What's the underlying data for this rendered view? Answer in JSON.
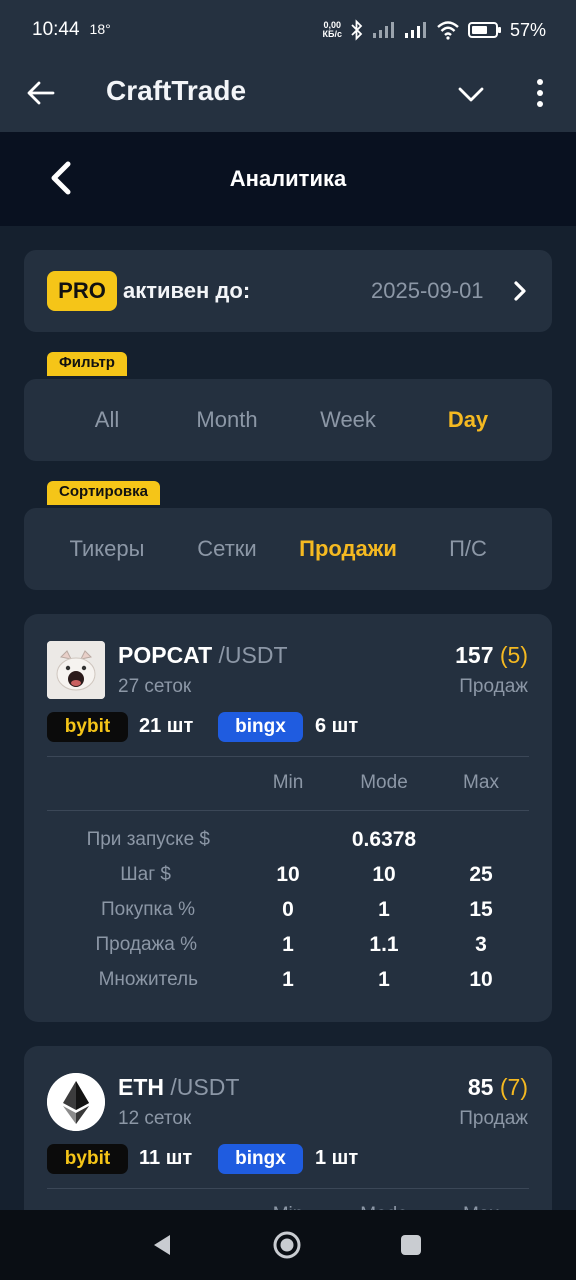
{
  "status_bar": {
    "time": "10:44",
    "temp": "18°",
    "net_speed_value": "0,00",
    "net_speed_unit": "КБ/с",
    "battery": "57%",
    "battery_pct_sign": "%"
  },
  "app_bar": {
    "title": "CraftTrade"
  },
  "page": {
    "title": "Аналитика"
  },
  "pro": {
    "badge": "PRO",
    "label": "активен до:",
    "date": "2025-09-01"
  },
  "filter": {
    "chip": "Фильтр",
    "tabs": [
      "All",
      "Month",
      "Week",
      "Day"
    ],
    "active": "Day"
  },
  "sort": {
    "chip": "Сортировка",
    "tabs": [
      "Тикеры",
      "Сетки",
      "Продажи",
      "П/С"
    ],
    "active": "Продажи"
  },
  "cards": [
    {
      "symbol": "POPCAT",
      "pair": "/USDT",
      "grids": "27 сеток",
      "sales": "157",
      "sales_extra": "(5)",
      "sales_label": "Продаж",
      "exchanges": [
        {
          "name": "bybit",
          "count": "21 шт"
        },
        {
          "name": "bingx",
          "count": "6 шт"
        }
      ],
      "columns": [
        "Min",
        "Mode",
        "Max"
      ],
      "rows": [
        {
          "label": "При запуске $",
          "values": [
            "",
            "0.6378",
            ""
          ]
        },
        {
          "label": "Шаг $",
          "values": [
            "10",
            "10",
            "25"
          ]
        },
        {
          "label": "Покупка %",
          "values": [
            "0",
            "1",
            "15"
          ]
        },
        {
          "label": "Продажа %",
          "values": [
            "1",
            "1.1",
            "3"
          ]
        },
        {
          "label": "Множитель",
          "values": [
            "1",
            "1",
            "10"
          ]
        }
      ]
    },
    {
      "symbol": "ETH",
      "pair": "/USDT",
      "grids": "12 сеток",
      "sales": "85",
      "sales_extra": "(7)",
      "sales_label": "Продаж",
      "exchanges": [
        {
          "name": "bybit",
          "count": "11 шт"
        },
        {
          "name": "bingx",
          "count": "1 шт"
        }
      ],
      "columns": [
        "Min",
        "Mode",
        "Max"
      ]
    }
  ],
  "colors": {
    "accent_yellow": "#f5b921",
    "bingx_blue": "#1f5ce0",
    "panel": "#24303f",
    "background": "#15202e"
  },
  "icons": {
    "back": "arrow-left-icon",
    "menu_toggle": "chevron-down-icon",
    "more": "more-vertical-icon",
    "page_back": "chevron-left-icon",
    "pro_open": "chevron-right-icon",
    "nav_back": "triangle-back-icon",
    "nav_home": "circle-home-icon",
    "nav_recent": "square-recent-icon"
  }
}
